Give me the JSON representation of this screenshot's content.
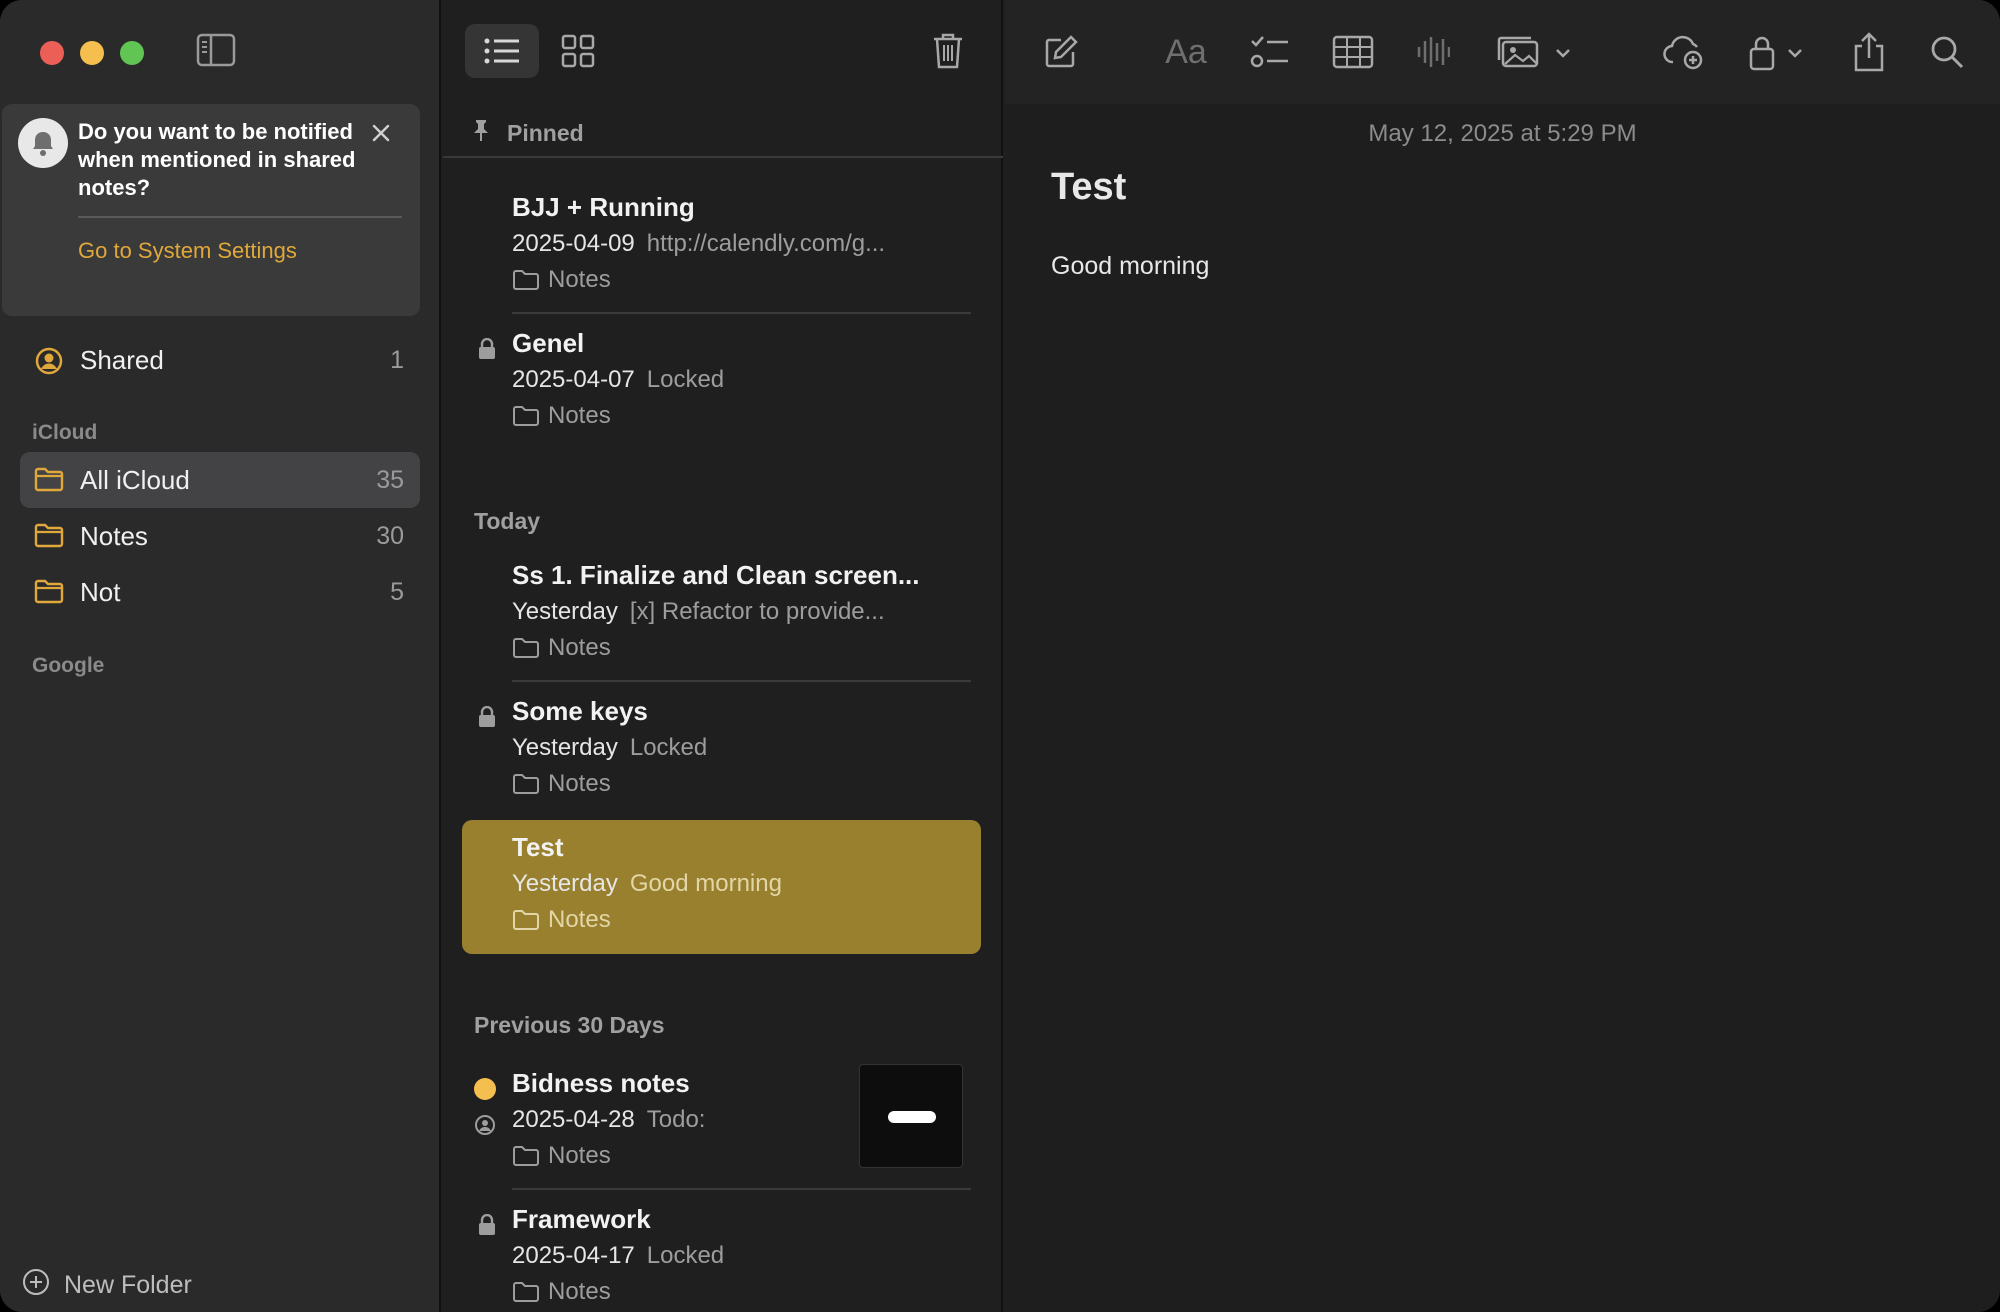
{
  "notification": {
    "message": "Do you want to be notified when mentioned in shared notes?",
    "link": "Go to System Settings"
  },
  "sidebar": {
    "shared": {
      "label": "Shared",
      "count": "1"
    },
    "sections": {
      "icloud": "iCloud",
      "google": "Google"
    },
    "folders": [
      {
        "label": "All iCloud",
        "count": "35"
      },
      {
        "label": "Notes",
        "count": "30"
      },
      {
        "label": "Not",
        "count": "5"
      }
    ],
    "new_folder": "New Folder"
  },
  "list": {
    "groups": {
      "pinned": "Pinned",
      "today": "Today",
      "previous": "Previous 30 Days"
    },
    "notes": [
      {
        "title": "BJJ + Running",
        "date": "2025-04-09",
        "preview": "http://calendly.com/g...",
        "folder": "Notes"
      },
      {
        "title": "Genel",
        "date": "2025-04-07",
        "preview": "Locked",
        "folder": "Notes"
      },
      {
        "title": "Ss 1. Finalize and Clean screen...",
        "date": "Yesterday",
        "preview": "[x] Refactor to provide...",
        "folder": "Notes"
      },
      {
        "title": "Some keys",
        "date": "Yesterday",
        "preview": "Locked",
        "folder": "Notes"
      },
      {
        "title": "Test",
        "date": "Yesterday",
        "preview": "Good morning",
        "folder": "Notes"
      },
      {
        "title": "Bidness notes",
        "date": "2025-04-28",
        "preview": "Todo:",
        "folder": "Notes"
      },
      {
        "title": "Framework",
        "date": "2025-04-17",
        "preview": "Locked",
        "folder": "Notes"
      }
    ]
  },
  "editor": {
    "timestamp": "May 12, 2025 at 5:29 PM",
    "title": "Test",
    "body": "Good morning",
    "format_label": "Aa"
  },
  "colors": {
    "accent": "#e0a83a",
    "selected_note": "#98802e",
    "pinned_dot": "#f4bf4f"
  }
}
